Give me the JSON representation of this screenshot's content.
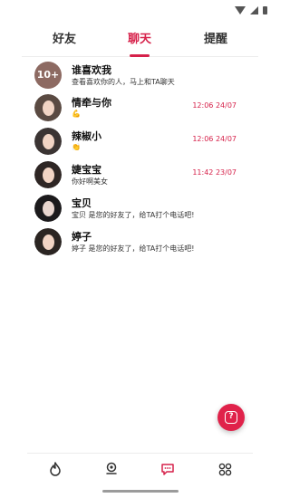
{
  "tabs": [
    {
      "label": "好友",
      "active": false
    },
    {
      "label": "聊天",
      "active": true
    },
    {
      "label": "提醒",
      "active": false
    }
  ],
  "chats": [
    {
      "name": "谁喜欢我",
      "preview": "查看喜欢你的人，马上和TA聊天",
      "time": "",
      "avatar_text": "10+"
    },
    {
      "name": "情牵与你",
      "preview": "💪",
      "time": "12:06 24/07",
      "avatar_text": ""
    },
    {
      "name": "辣椒小",
      "preview": "👏",
      "time": "12:06 24/07",
      "avatar_text": ""
    },
    {
      "name": "婕宝宝",
      "preview": "你好啊美女",
      "time": "11:42 23/07",
      "avatar_text": ""
    },
    {
      "name": "宝贝",
      "preview": "宝贝 是您的好友了，给TA打个电话吧!",
      "time": "",
      "avatar_text": ""
    },
    {
      "name": "婷子",
      "preview": "婷子 是您的好友了，给TA打个电话吧!",
      "time": "",
      "avatar_text": ""
    }
  ],
  "bottom_nav": [
    {
      "icon": "flame-icon",
      "active": false
    },
    {
      "icon": "location-pin-icon",
      "active": false
    },
    {
      "icon": "chat-bubble-icon",
      "active": true
    },
    {
      "icon": "grid-icon",
      "active": false
    }
  ],
  "help_button": {
    "icon": "question-icon"
  },
  "colors": {
    "accent": "#d6214a",
    "fab": "#e0224a",
    "icon_inactive": "#333333"
  }
}
